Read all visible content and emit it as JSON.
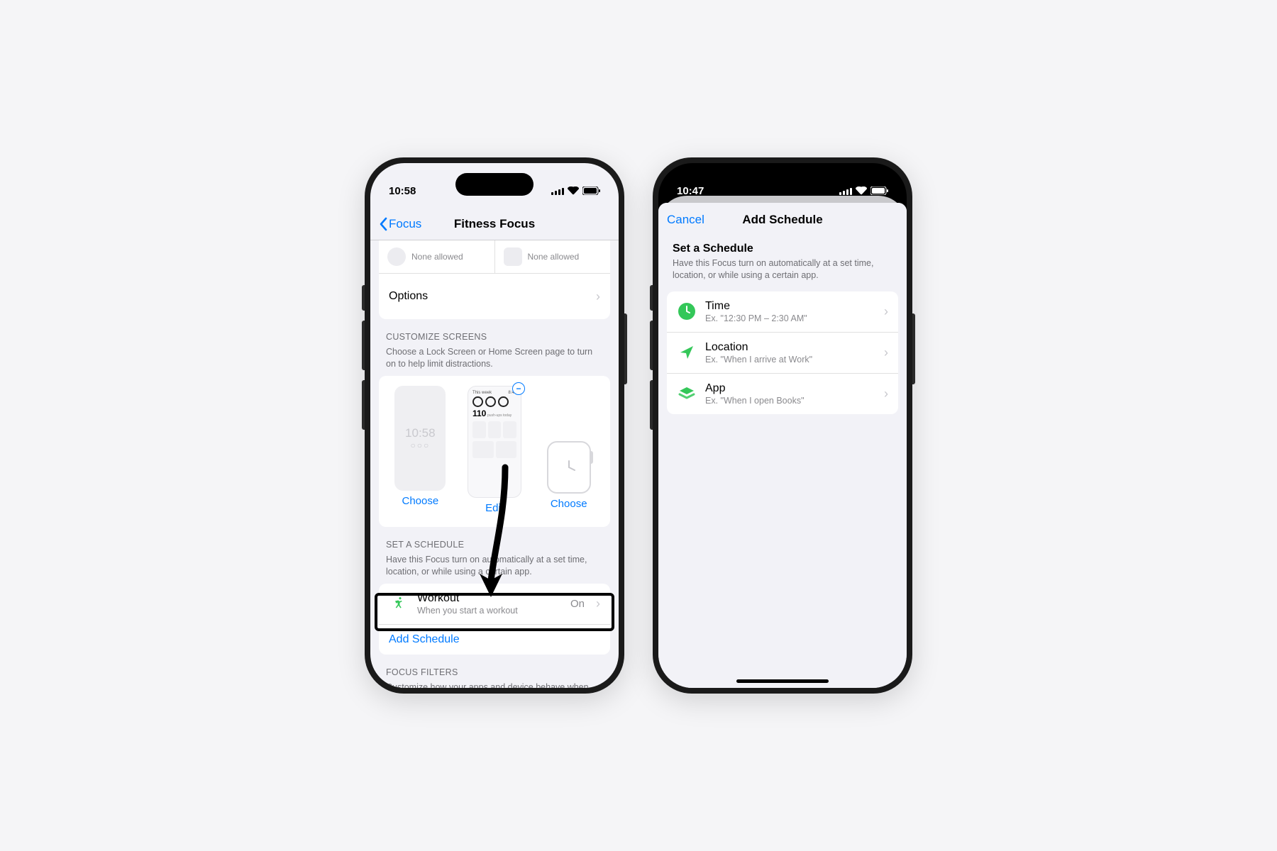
{
  "left": {
    "status_time": "10:58",
    "nav_back": "Focus",
    "nav_title": "Fitness Focus",
    "allowed_people": "None allowed",
    "allowed_apps": "None allowed",
    "options_label": "Options",
    "customize_header": "CUSTOMIZE SCREENS",
    "customize_sub": "Choose a Lock Screen or Home Screen page to turn on to help limit distractions.",
    "lock_time": "10:58",
    "home_preview_label": "This week",
    "home_preview_value": "8:40",
    "home_preview_number": "110",
    "home_preview_caption": "push-ups today",
    "choose_label": "Choose",
    "edit_label": "Edit",
    "schedule_header": "SET A SCHEDULE",
    "schedule_sub": "Have this Focus turn on automatically at a set time, location, or while using a certain app.",
    "workout_title": "Workout",
    "workout_sub": "When you start a workout",
    "workout_state": "On",
    "add_schedule": "Add Schedule",
    "filters_header": "FOCUS FILTERS",
    "filters_sub": "Customize how your apps and device behave when this Focus is on."
  },
  "right": {
    "status_time": "10:47",
    "cancel": "Cancel",
    "title": "Add Schedule",
    "heading": "Set a Schedule",
    "sub": "Have this Focus turn on automatically at a set time, location, or while using a certain app.",
    "rows": [
      {
        "title": "Time",
        "sub": "Ex. \"12:30 PM – 2:30 AM\"",
        "icon": "clock",
        "color": "#34c759",
        "shape": "circle"
      },
      {
        "title": "Location",
        "sub": "Ex. \"When I arrive at Work\"",
        "icon": "location",
        "color": "#34c759",
        "shape": "arrow"
      },
      {
        "title": "App",
        "sub": "Ex. \"When I open Books\"",
        "icon": "app",
        "color": "#34c759",
        "shape": "stack"
      }
    ]
  }
}
